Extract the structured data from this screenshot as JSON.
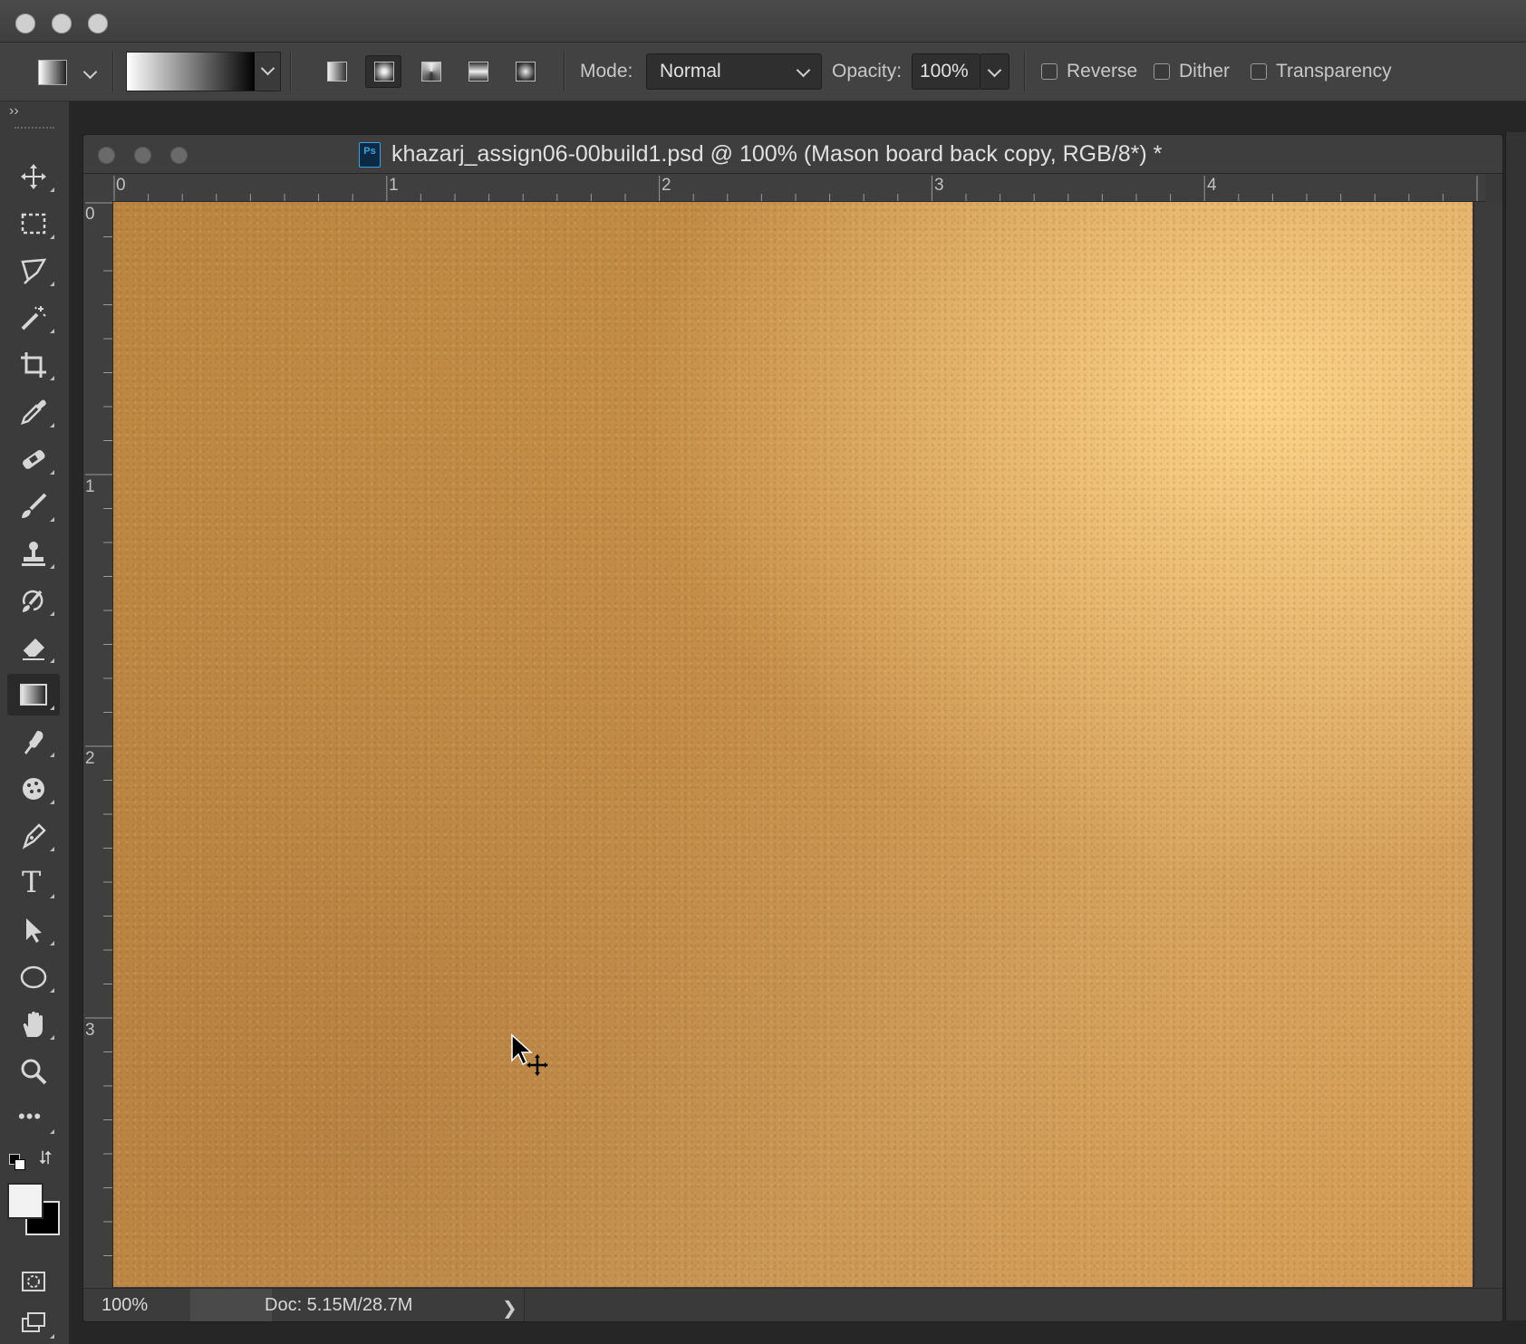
{
  "window": {
    "traffic_lights": [
      "close",
      "minimize",
      "zoom"
    ]
  },
  "options_bar": {
    "tool_preset": "gradient-tool-preset",
    "gradient_picker": "black-white-gradient",
    "gradient_types": [
      "linear",
      "radial",
      "angle",
      "reflected",
      "diamond"
    ],
    "active_gradient_type": "radial",
    "mode_label": "Mode:",
    "mode_value": "Normal",
    "opacity_label": "Opacity:",
    "opacity_value": "100%",
    "reverse_label": "Reverse",
    "dither_label": "Dither",
    "transparency_label": "Transparency",
    "reverse_checked": false,
    "dither_checked": false,
    "transparency_checked": false
  },
  "tools": {
    "expand_glyph": "››",
    "items": [
      {
        "name": "move-tool",
        "icon": "move-icon"
      },
      {
        "name": "rectangular-marquee-tool",
        "icon": "marquee-icon"
      },
      {
        "name": "lasso-tool",
        "icon": "lasso-icon"
      },
      {
        "name": "magic-wand-tool",
        "icon": "magic-wand-icon"
      },
      {
        "name": "crop-tool",
        "icon": "crop-icon"
      },
      {
        "name": "eyedropper-tool",
        "icon": "eyedropper-icon"
      },
      {
        "name": "healing-brush-tool",
        "icon": "bandage-icon"
      },
      {
        "name": "brush-tool",
        "icon": "brush-icon"
      },
      {
        "name": "clone-stamp-tool",
        "icon": "stamp-icon"
      },
      {
        "name": "history-brush-tool",
        "icon": "history-brush-icon"
      },
      {
        "name": "eraser-tool",
        "icon": "eraser-icon"
      },
      {
        "name": "gradient-tool",
        "icon": "gradient-icon",
        "active": true
      },
      {
        "name": "smudge-tool",
        "icon": "smudge-icon"
      },
      {
        "name": "sponge-tool",
        "icon": "sponge-icon"
      },
      {
        "name": "pen-tool",
        "icon": "pen-icon"
      },
      {
        "name": "type-tool",
        "icon": "type-icon",
        "glyph": "T"
      },
      {
        "name": "path-selection-tool",
        "icon": "arrow-icon"
      },
      {
        "name": "ellipse-tool",
        "icon": "ellipse-icon"
      },
      {
        "name": "hand-tool",
        "icon": "hand-icon"
      },
      {
        "name": "zoom-tool",
        "icon": "zoom-icon"
      },
      {
        "name": "edit-toolbar",
        "icon": "more-icon",
        "glyph": "•••"
      }
    ],
    "foreground_color": "#f2f2f2",
    "background_color": "#000000"
  },
  "document": {
    "title": "khazarj_assign06-00build1.psd @ 100% (Mason board back copy, RGB/8*) *",
    "ps_icon_label": "Ps",
    "ruler_h_labels": [
      "0",
      "1",
      "2",
      "3",
      "4"
    ],
    "ruler_v_labels": [
      "0",
      "1",
      "2",
      "3"
    ],
    "zoom": "100%",
    "doc_info": "Doc: 5.15M/28.7M",
    "status_arrow": "❯",
    "canvas_color": "#c9914b"
  }
}
